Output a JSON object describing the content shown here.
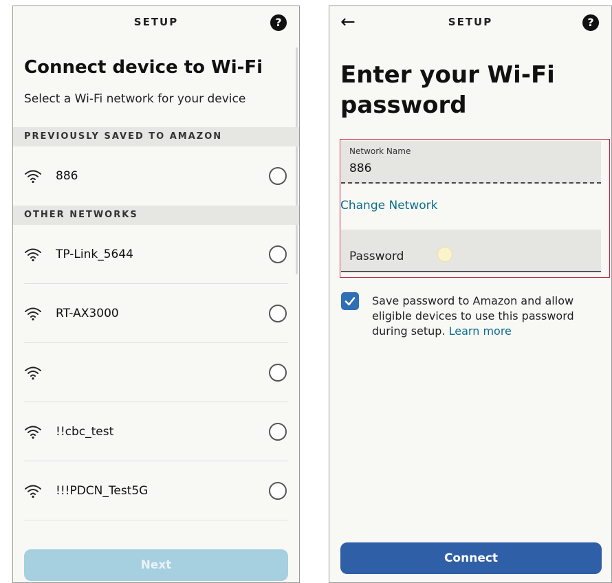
{
  "left": {
    "title": "SETUP",
    "help_icon": "?",
    "heading": "Connect device to Wi-Fi",
    "subheading": "Select a Wi-Fi network for your device",
    "saved_section": "PREVIOUSLY SAVED TO AMAZON",
    "saved_networks": [
      {
        "name": "886",
        "icon": "wifi-icon"
      }
    ],
    "other_section": "OTHER NETWORKS",
    "other_networks": [
      {
        "name": "TP-Link_5644",
        "icon": "wifi-icon"
      },
      {
        "name": "RT-AX3000",
        "icon": "wifi-icon"
      },
      {
        "name": "",
        "icon": "wifi-icon"
      },
      {
        "name": "!!cbc_test",
        "icon": "wifi-icon"
      },
      {
        "name": "!!!PDCN_Test5G",
        "icon": "wifi-icon"
      }
    ],
    "next_button": "Next"
  },
  "right": {
    "title": "SETUP",
    "help_icon": "?",
    "back_icon": "←",
    "heading": "Enter your Wi-Fi password",
    "network_name_label": "Network Name",
    "network_name_value": "886",
    "change_network": "Change Network",
    "password_label": "Password",
    "save_text": "Save password to Amazon and allow eligible devices to use this password during setup.",
    "learn_more": "Learn more",
    "checkbox_checked": true,
    "connect_button": "Connect"
  },
  "colors": {
    "link": "#0b6e8e",
    "primary_button": "#2f5fa6",
    "disabled_button": "#a6cfe0",
    "highlight_box": "#c4213a",
    "checkbox": "#2e6fb5"
  }
}
